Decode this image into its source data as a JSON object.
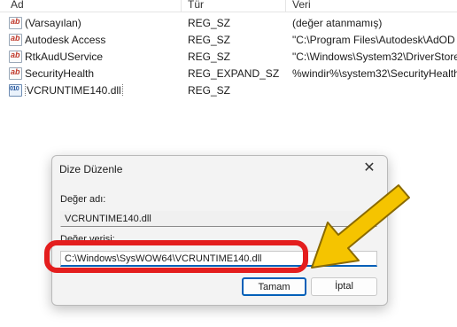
{
  "list": {
    "headers": {
      "name": "Ad",
      "type": "Tür",
      "data": "Veri"
    },
    "rows": [
      {
        "icon": "string-value-icon",
        "name": "(Varsayılan)",
        "type": "REG_SZ",
        "data": "(değer atanmamış)"
      },
      {
        "icon": "string-value-icon",
        "name": "Autodesk Access",
        "type": "REG_SZ",
        "data": "\"C:\\Program Files\\Autodesk\\AdOD"
      },
      {
        "icon": "string-value-icon",
        "name": "RtkAudUService",
        "type": "REG_SZ",
        "data": "\"C:\\Windows\\System32\\DriverStore"
      },
      {
        "icon": "string-value-icon",
        "name": "SecurityHealth",
        "type": "REG_EXPAND_SZ",
        "data": "%windir%\\system32\\SecurityHealth"
      },
      {
        "icon": "binary-value-icon",
        "name": "VCRUNTIME140.dll",
        "type": "REG_SZ",
        "data": ""
      }
    ]
  },
  "dialog": {
    "title": "Dize Düzenle",
    "name_label": "Değer adı:",
    "name_value": "VCRUNTIME140.dll",
    "data_label": "Değer verisi:",
    "data_value": "C:\\Windows\\SysWOW64\\VCRUNTIME140.dll",
    "ok_label": "Tamam",
    "cancel_label": "İptal"
  },
  "annotation": {
    "highlight_color": "#e41e1e",
    "arrow_color": "#f5c400"
  }
}
